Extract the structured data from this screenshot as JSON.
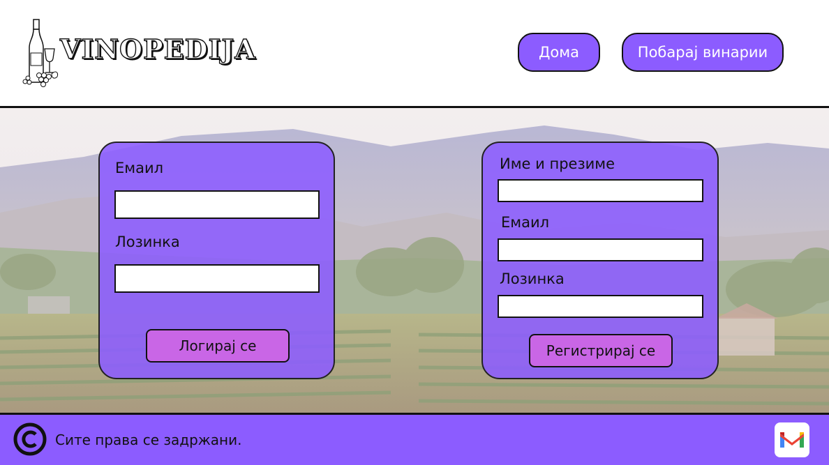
{
  "header": {
    "brand": "VINOPEDIJA",
    "nav": {
      "home_label": "Дома",
      "search_label": "Побарај винарии"
    }
  },
  "login": {
    "email_label": "Емаил",
    "email_value": "",
    "password_label": "Лозинка",
    "password_value": "",
    "submit_label": "Логирај се"
  },
  "register": {
    "name_label": "Име и презиме",
    "name_value": "",
    "email_label": "Емаил",
    "email_value": "",
    "password_label": "Лозинка",
    "password_value": "",
    "submit_label": "Регистрирај се"
  },
  "footer": {
    "copyright_text": "Сите права се задржани.",
    "copyright_icon": "copyright-icon",
    "mail_icon": "gmail-icon"
  },
  "colors": {
    "accent": "#8c5cff",
    "button_pink": "#c966e6"
  }
}
